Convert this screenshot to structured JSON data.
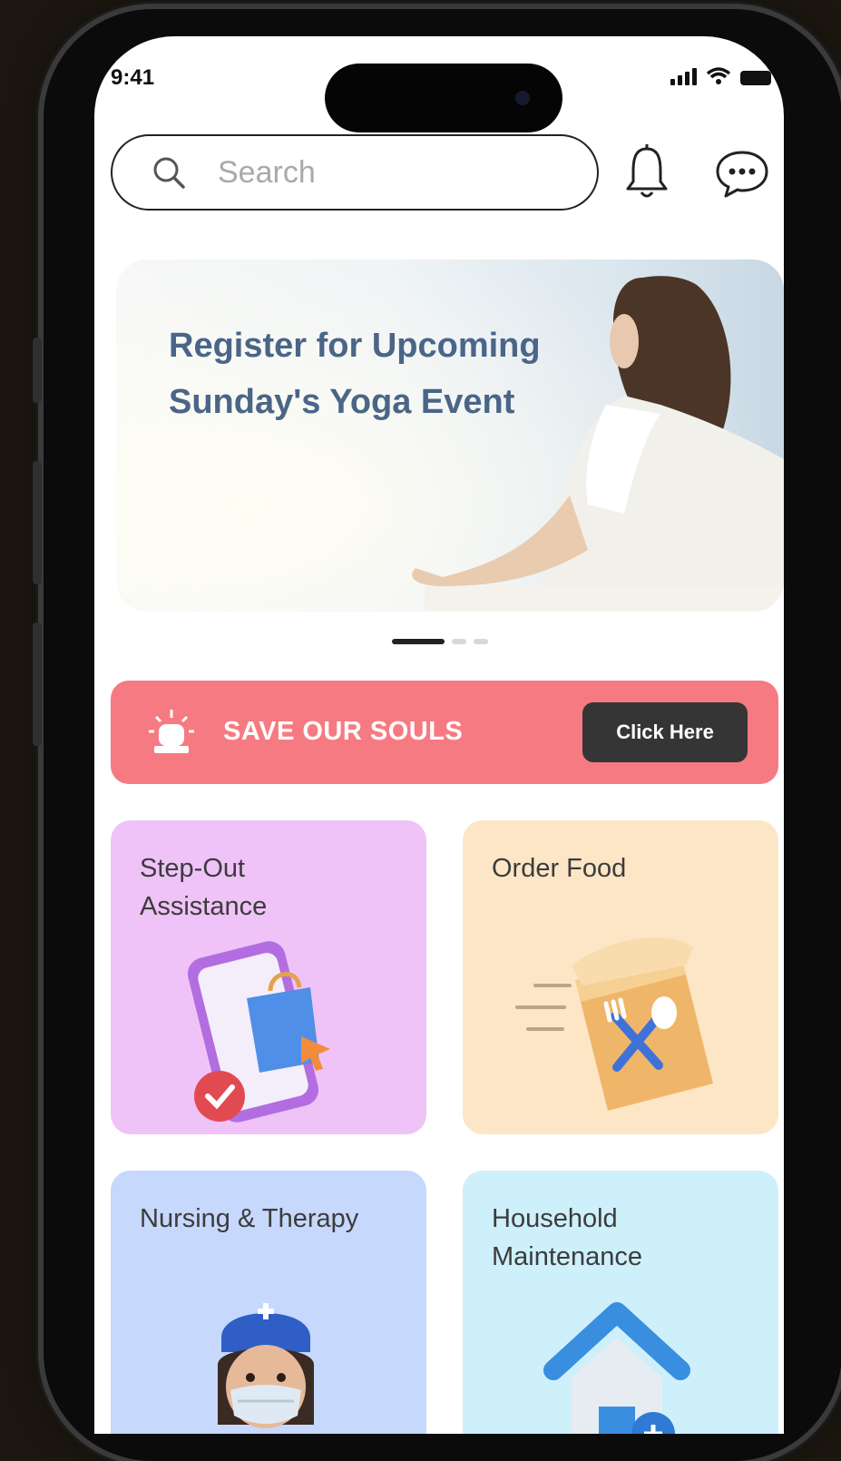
{
  "status_bar": {
    "time": "9:41"
  },
  "search": {
    "placeholder": "Search"
  },
  "banner": {
    "title": "Register for Upcoming Sunday's Yoga Event"
  },
  "carousel": {
    "active_index": 0,
    "count": 3
  },
  "sos": {
    "label": "SAVE OUR SOULS",
    "button_label": "Click Here"
  },
  "services": [
    {
      "label": "Step-Out Assistance",
      "icon": "shopping-phone-icon"
    },
    {
      "label": "Order Food",
      "icon": "food-bag-icon"
    },
    {
      "label": "Nursing & Therapy",
      "icon": "nurse-icon"
    },
    {
      "label": "Household Maintenance",
      "icon": "house-icon"
    }
  ],
  "colors": {
    "sos_bg": "#f67a82",
    "step_out_bg": "#efc3f7",
    "order_food_bg": "#fde6c6",
    "nursing_bg": "#c6d8fb",
    "household_bg": "#cdf0fb",
    "banner_text": "#4a6587"
  }
}
